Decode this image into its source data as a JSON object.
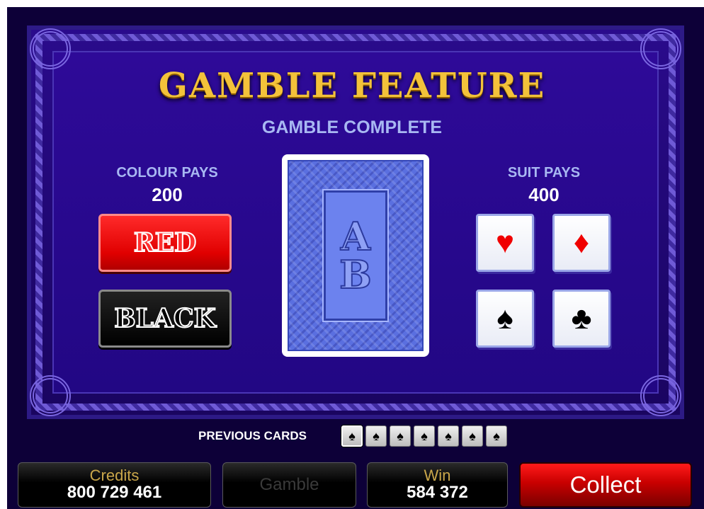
{
  "title": "GAMBLE FEATURE",
  "status": "GAMBLE COMPLETE",
  "colour_pays": {
    "label": "COLOUR PAYS",
    "value": "200"
  },
  "suit_pays": {
    "label": "SUIT PAYS",
    "value": "400"
  },
  "buttons": {
    "red": "RED",
    "black": "BLACK"
  },
  "card_back": {
    "monogram_top": "A",
    "monogram_bottom": "B"
  },
  "suits": [
    {
      "name": "heart",
      "glyph": "♥"
    },
    {
      "name": "diamond",
      "glyph": "♦"
    },
    {
      "name": "spade",
      "glyph": "♠"
    },
    {
      "name": "club",
      "glyph": "♣"
    }
  ],
  "previous_cards": {
    "label": "PREVIOUS CARDS",
    "cards": [
      "♠",
      "♠",
      "♠",
      "♠",
      "♠",
      "♠",
      "♠"
    ]
  },
  "footer": {
    "credits_label": "Credits",
    "credits_value": "800 729 461",
    "gamble_label": "Gamble",
    "win_label": "Win",
    "win_value": "584 372",
    "collect_label": "Collect"
  },
  "colors": {
    "title_gold": "#f3c23a",
    "board_blue": "#2e0a98",
    "red_button": "#e00000",
    "collect_red": "#c80000"
  }
}
